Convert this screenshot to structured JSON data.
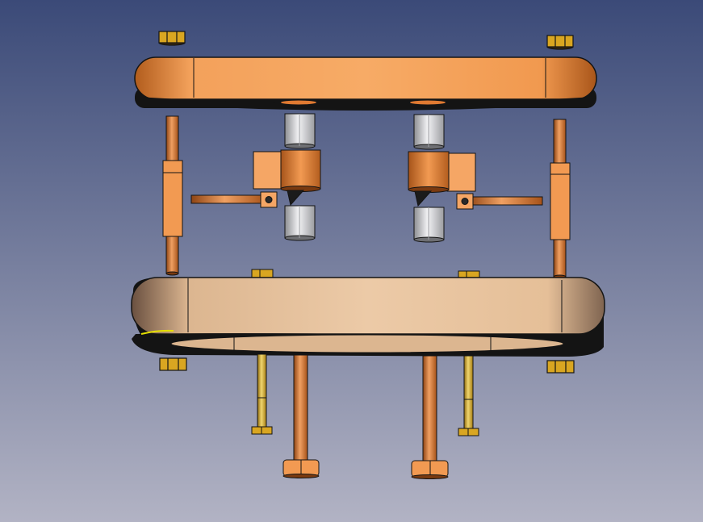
{
  "viewport": {
    "background_top": "#3b4a78",
    "background_bottom": "#b2b3c4"
  },
  "model": {
    "colors": {
      "copper": "#e07a32",
      "copper_light": "#f5a665",
      "copper_dark": "#9b4d1a",
      "beige": "#e9c7a3",
      "beige_dark": "#b58d69",
      "brass": "#d5a41e",
      "brass_light": "#ecd06a",
      "steel": "#c4c5c9",
      "steel_light": "#eeeef0",
      "edge": "#141414"
    }
  }
}
